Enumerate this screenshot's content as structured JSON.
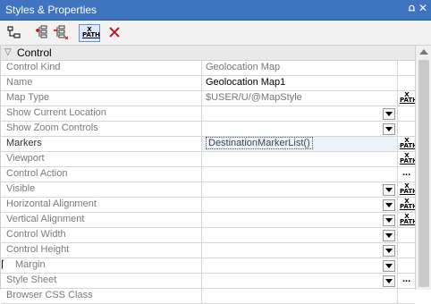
{
  "window": {
    "title": "Styles & Properties",
    "pin_glyph": "⩍",
    "close_glyph": "✕"
  },
  "toolbar": {
    "buttons": [
      {
        "name": "hierarchy-icon"
      },
      {
        "name": "add-style-icon"
      },
      {
        "name": "remove-style-icon"
      },
      {
        "name": "xpath-icon",
        "label": "X PATH",
        "active": true
      },
      {
        "name": "delete-icon"
      }
    ]
  },
  "section": {
    "label": "Control"
  },
  "properties": [
    {
      "name": "Control Kind",
      "value": "Geolocation Map",
      "gray": true
    },
    {
      "name": "Name",
      "value": "Geolocation Map1"
    },
    {
      "name": "Map Type",
      "value": "$USER/U/@MapStyle",
      "gray": true,
      "btn": "xpath"
    },
    {
      "name": "Show Current Location",
      "dropdown": true
    },
    {
      "name": "Show Zoom Controls",
      "dropdown": true
    },
    {
      "name": "Markers",
      "value": "DestinationMarkerList()",
      "selected": true,
      "btn": "xpath"
    },
    {
      "name": "Viewport",
      "btn": "xpath"
    },
    {
      "name": "Control Action",
      "btn": "ellipsis"
    },
    {
      "name": "Visible",
      "dropdown": true,
      "btn": "xpath"
    },
    {
      "name": "Horizontal Alignment",
      "dropdown": true,
      "btn": "xpath"
    },
    {
      "name": "Vertical Alignment",
      "dropdown": true,
      "btn": "xpath"
    },
    {
      "name": "Control Width",
      "dropdown": true
    },
    {
      "name": "Control Height",
      "dropdown": true
    },
    {
      "name": "Margin",
      "dropdown": true,
      "group": true
    },
    {
      "name": "Style Sheet",
      "dropdown": true,
      "btn": "ellipsis"
    },
    {
      "name": "Browser CSS Class"
    }
  ],
  "labels": {
    "xpath_top": "X",
    "xpath_bottom": "PATH",
    "ellipsis": "..."
  }
}
